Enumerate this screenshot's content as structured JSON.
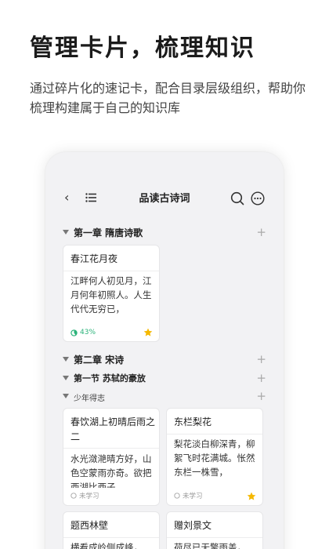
{
  "promo": {
    "headline": "管理卡片，梳理知识",
    "subline": "通过碎片化的速记卡，配合目录层级组织，帮助你梳理构建属于自己的知识库"
  },
  "app": {
    "title": "品读古诗词",
    "sections": {
      "ch1": "第一章 隋唐诗歌",
      "ch2": "第二章 宋诗",
      "sec1": "第一节 苏轼的豪放",
      "sub1": "少年得志"
    },
    "cards": [
      {
        "title": "春江花月夜",
        "body": "江畔何人初见月，江月何年初照人。人生代代无穷已，",
        "progress": "43%",
        "starred": true
      },
      {
        "title": "春饮湖上初晴后雨之二",
        "body": "水光潋滟晴方好，山色空蒙雨亦奇。欲把西湖比西子，",
        "status": "未学习",
        "starred": false
      },
      {
        "title": "东栏梨花",
        "body": "梨花淡白柳深青，柳絮飞时花满城。怅然东栏一株雪，",
        "status": "未学习",
        "starred": true
      },
      {
        "title": "题西林壁",
        "body": "横看成岭侧成峰，",
        "starred": false
      },
      {
        "title": "赠刘景文",
        "body": "荷尽已无擎雨盖，",
        "starred": false
      }
    ],
    "colors": {
      "accent_green": "#2bb37a",
      "star": "#f5b800",
      "background": "#f2f2f4"
    }
  }
}
